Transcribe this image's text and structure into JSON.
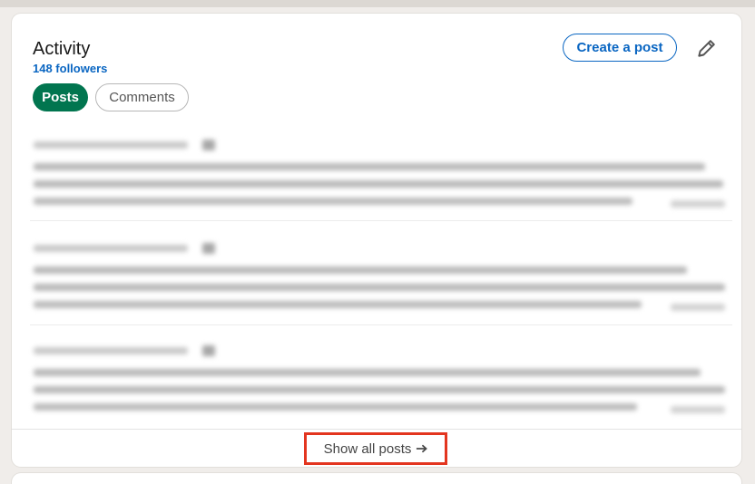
{
  "activity": {
    "title": "Activity",
    "followers": "148 followers",
    "create_post_label": "Create a post",
    "edit_icon": "pencil-icon",
    "filters": [
      {
        "label": "Posts",
        "selected": true
      },
      {
        "label": "Comments",
        "selected": false
      }
    ],
    "show_all_label": "Show all posts",
    "show_all_icon": "arrow-right-icon"
  },
  "colors": {
    "accent_blue": "#0a66c2",
    "selected_pill": "#01754f",
    "highlight_box": "#e3351f"
  }
}
